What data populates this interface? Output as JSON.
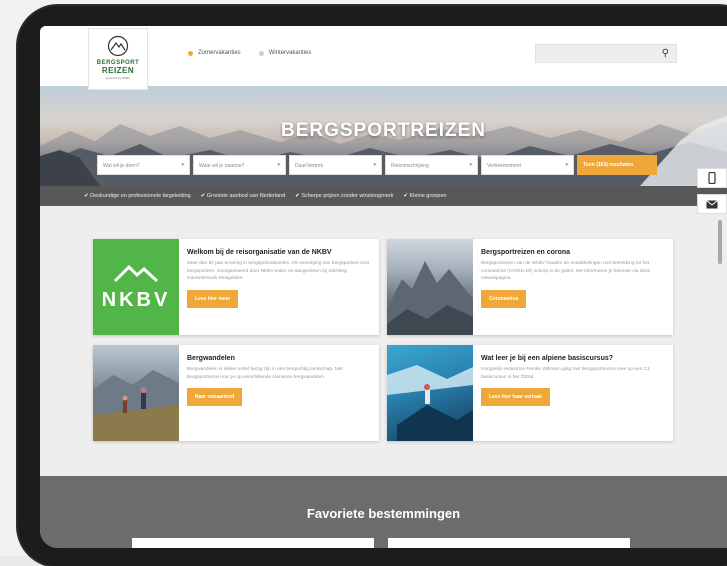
{
  "brand": {
    "line1": "BERGSPORT",
    "line2": "REIZEN",
    "tagline": "powered by NKBV"
  },
  "tabs": [
    {
      "label": "Zomervakanties",
      "color": "#f0a73a"
    },
    {
      "label": "Wintervakanties",
      "color": "#cfcfcf"
    }
  ],
  "search": {
    "placeholder": "",
    "icon": "search-icon"
  },
  "hero": {
    "title": "BERGSPORTREIZEN"
  },
  "filters": [
    {
      "label": "Wat wil je doen?"
    },
    {
      "label": "Waar wil je naartoe?"
    },
    {
      "label": "Duur/Vertrek"
    },
    {
      "label": "Reisomschrijving"
    },
    {
      "label": "Vertrekmoment"
    }
  ],
  "show_button": "Toon (163) resultaten",
  "usps": [
    "Deskundige en professionele begeleiding",
    "Grootste aanbod van Nederland",
    "Scherpe prijzen zonder winstoogmerk",
    "Kleine groepen"
  ],
  "cards": [
    {
      "title": "Welkom bij de reisorganisatie van de NKBV",
      "text": "Meer dan 90 jaar ervaring in bergsportvakanties. Als vereniging van bergsporters voor bergsporters. Georganiseerd door NKBV-leden en aangesloten bij Stichting Garantiefonds Reisgelden.",
      "button": "Lees hier meer",
      "logo_text": "NKBV"
    },
    {
      "title": "Bergsportreizen en corona",
      "text": "Bergsportreizen van de NKBV houden de ontwikkelingen met betrekking tot het coronavirus (COVID-19) scherp in de gaten. We informeren je hierover via deze nieuwspagina.",
      "button": "Coronavirus"
    },
    {
      "title": "Bergwandelen",
      "text": "Bergwandelen is lekker actief bezig zijn in een bergachtig landschap. Met Bergsportreizen kun je op verschillende manieren bergwandelen.",
      "button": "Naar reisaanbod"
    },
    {
      "title": "Wat leer je bij een alpiene basiscursus?",
      "text": "Hoogtelijn-redactrice Femke Wilmsen ging met Bergsportreizen mee op een C1 basiscursus in het Ötztal.",
      "button": "Lees hier haar verhaal"
    }
  ],
  "favorites": {
    "title": "Favoriete bestemmingen"
  },
  "colors": {
    "accent": "#f0a73a",
    "nkbv_green": "#52b548",
    "usp_bar": "#585858"
  }
}
